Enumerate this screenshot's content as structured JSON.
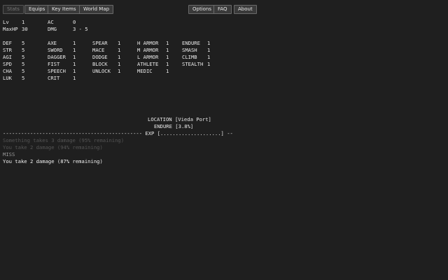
{
  "nav": {
    "tabs": [
      "Stats",
      "Equips",
      "Key Items",
      "World Map"
    ],
    "right": [
      "Options",
      "FAQ",
      "About"
    ]
  },
  "core": {
    "lv_label": "Lv",
    "lv": "1",
    "maxhp_label": "MaxHP",
    "maxhp": "30",
    "ac_label": "AC",
    "ac": "0",
    "dmg_label": "DMG",
    "dmg": "3 - 5"
  },
  "attributes": [
    {
      "label": "DEF",
      "value": "5"
    },
    {
      "label": "STR",
      "value": "5"
    },
    {
      "label": "AGI",
      "value": "5"
    },
    {
      "label": "SPD",
      "value": "5"
    },
    {
      "label": "CHA",
      "value": "5"
    },
    {
      "label": "LUK",
      "value": "5"
    }
  ],
  "skills_col1": [
    {
      "label": "AXE",
      "value": "1"
    },
    {
      "label": "SWORD",
      "value": "1"
    },
    {
      "label": "DAGGER",
      "value": "1"
    },
    {
      "label": "FIST",
      "value": "1"
    },
    {
      "label": "SPEECH",
      "value": "1"
    },
    {
      "label": "CRIT",
      "value": "1"
    }
  ],
  "skills_col2": [
    {
      "label": "SPEAR",
      "value": "1"
    },
    {
      "label": "MACE",
      "value": "1"
    },
    {
      "label": "DODGE",
      "value": "1"
    },
    {
      "label": "BLOCK",
      "value": "1"
    },
    {
      "label": "UNLOCK",
      "value": "1"
    }
  ],
  "skills_col3": [
    {
      "label": "H ARMOR",
      "value": "1"
    },
    {
      "label": "M ARMOR",
      "value": "1"
    },
    {
      "label": "L ARMOR",
      "value": "1"
    },
    {
      "label": "ATHLETE",
      "value": "1"
    },
    {
      "label": "MEDIC",
      "value": "1"
    }
  ],
  "skills_col4": [
    {
      "label": "ENDURE",
      "value": "1"
    },
    {
      "label": "SMASH",
      "value": "1"
    },
    {
      "label": "CLIMB",
      "value": "1"
    },
    {
      "label": "STEALTH",
      "value": "1"
    }
  ],
  "location": "LOCATION [Vieda Port]",
  "training": "ENDURE [3.8%]",
  "exp_bar": "---------------------------------------------- EXP [....................] --",
  "log": [
    {
      "text": "Something takes 3 damage (95% remaining)",
      "style": "faded"
    },
    {
      "text": "You take 2 damage (94% remaining)",
      "style": "faded"
    },
    {
      "text": "MISS",
      "style": "dim"
    },
    {
      "text": "You take 2 damage (87% remaining)",
      "style": "bright"
    }
  ]
}
